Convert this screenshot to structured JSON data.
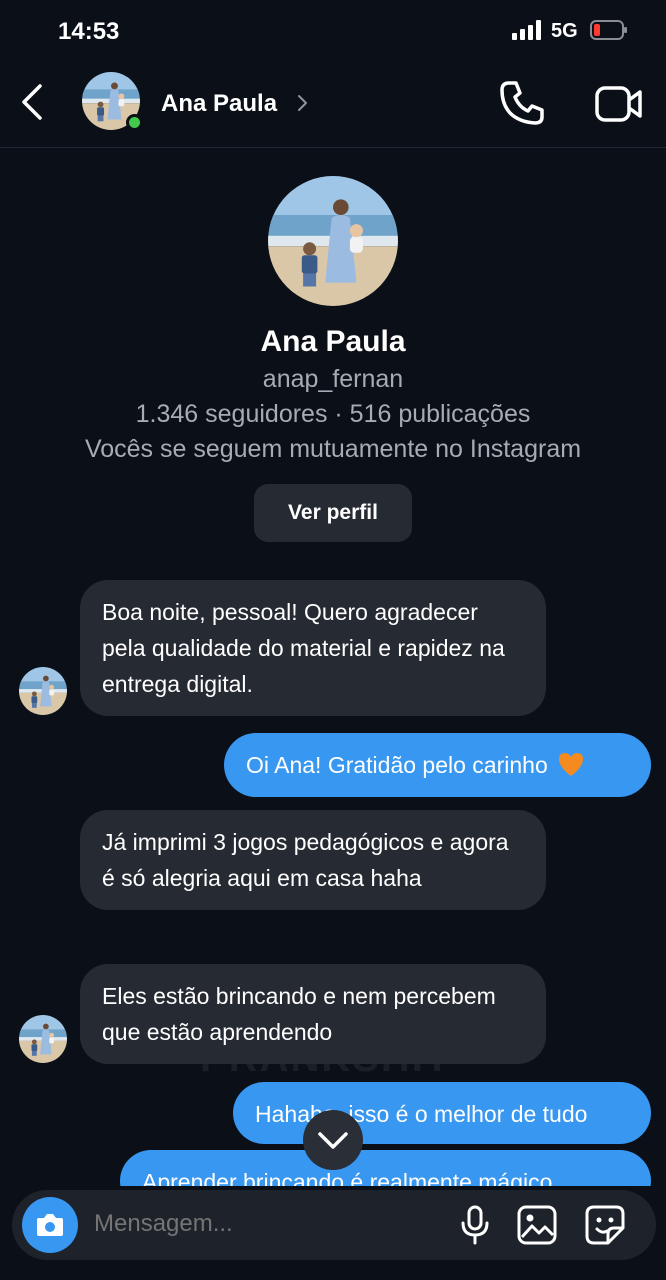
{
  "status_bar": {
    "time": "14:53",
    "network": "5G"
  },
  "header": {
    "contact_name": "Ana Paula"
  },
  "profile": {
    "name": "Ana Paula",
    "username": "anap_fernan",
    "stats": "1.346 seguidores · 516 publicações",
    "mutual": "Vocês se seguem mutuamente no Instagram",
    "view_profile_label": "Ver perfil"
  },
  "messages": [
    {
      "direction": "in",
      "text": "Boa noite, pessoal! Quero agradecer pela qualidade do material e rapidez na entrega digital."
    },
    {
      "direction": "out",
      "text": "Oi Ana! Gratidão pelo carinho"
    },
    {
      "direction": "in",
      "text": "Já imprimi 3 jogos pedagógicos e agora é só alegria aqui em casa haha"
    },
    {
      "direction": "in",
      "text": "Eles estão brincando e nem percebem que estão aprendendo"
    },
    {
      "direction": "out",
      "text": "Hahaha, isso é o melhor de tudo"
    },
    {
      "direction": "out",
      "text": "Aprender brincando é realmente mágico"
    }
  ],
  "watermark": "PRANKSHIT",
  "composer": {
    "placeholder": "Mensagem..."
  },
  "colors": {
    "background": "#0b0f17",
    "incoming_bubble": "#262a33",
    "outgoing_bubble": "#3897f0",
    "online": "#43c94b",
    "heart": "#f58a1f"
  },
  "icons": [
    "back-arrow-icon",
    "chevron-right-icon",
    "phone-icon",
    "video-camera-icon",
    "chevron-down-icon",
    "camera-icon",
    "microphone-icon",
    "image-icon",
    "sticker-icon",
    "heart-icon"
  ]
}
